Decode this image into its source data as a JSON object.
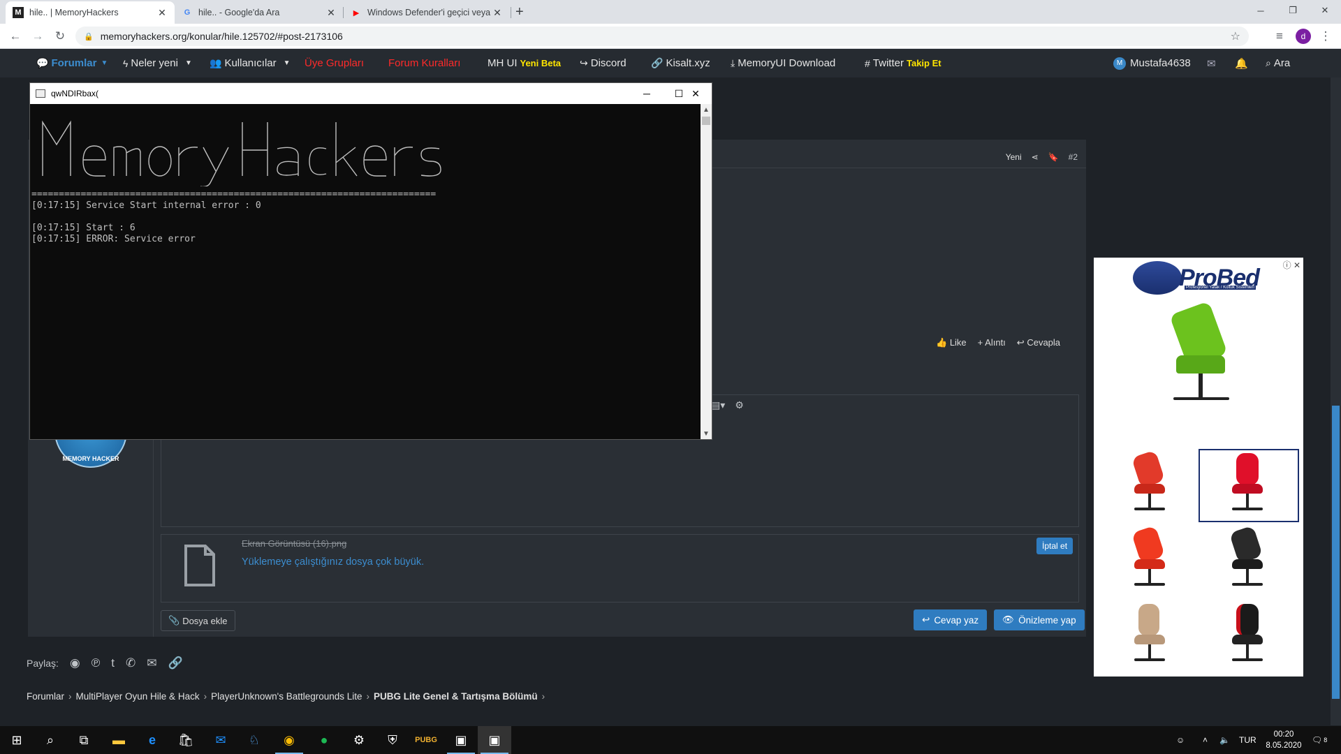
{
  "browser": {
    "tabs": [
      {
        "title": "hile.. | MemoryHackers",
        "favicon": "M"
      },
      {
        "title": "hile.. - Google'da Ara",
        "favicon": "G"
      },
      {
        "title": "Windows Defender'i geçici veya k",
        "favicon": "▶"
      }
    ],
    "url": "memoryhackers.org/konular/hile.125702/#post-2173106",
    "profile_initial": "d"
  },
  "forum_nav": {
    "forums": "Forumlar",
    "whats_new": "Neler yeni",
    "members": "Kullanıcılar",
    "groups": "Üye Grupları",
    "rules": "Forum Kuralları",
    "mhui": "MH UI",
    "mhui_badge": "Yeni Beta",
    "discord": "Discord",
    "kisalt": "Kisalt.xyz",
    "download": "MemoryUI Download",
    "twitter": "Twitter",
    "twitter_badge": "Takip Et",
    "username": "Mustafa4638",
    "search": "Ara"
  },
  "post": {
    "new_label": "Yeni",
    "number": "#2",
    "like": "Like",
    "quote": "Alıntı",
    "reply": "Cevapla"
  },
  "attachment": {
    "filename": "Ekran Görüntüsü (16).png",
    "error": "Yüklemeye çalıştığınız dosya çok büyük.",
    "cancel": "İptal et"
  },
  "buttons": {
    "add_file": "Dosya ekle",
    "post_reply": "Cevap yaz",
    "preview": "Önizleme yap"
  },
  "share": {
    "label": "Paylaş:"
  },
  "breadcrumb": [
    "Forumlar",
    "MultiPlayer Oyun Hile & Hack",
    "PlayerUnknown's Battlegrounds Lite",
    "PUBG Lite Genel & Tartışma Bölümü"
  ],
  "logo_text": "MEMORY HACKER",
  "ad": {
    "brand": "ProBed",
    "tagline": "Profesyonel Yatak / Koltuk Sistemleri"
  },
  "console": {
    "title": "qwNDIRbax(",
    "separator": "==========================================================================",
    "lines": [
      "[0:17:15] Service Start internal error : 0",
      "",
      "[0:17:15] Start : 6",
      "[0:17:15] ERROR: Service error"
    ]
  },
  "taskbar": {
    "language": "TUR",
    "time": "00:20",
    "date": "8.05.2020",
    "notification_count": "8"
  },
  "colors": {
    "accent_blue": "#2f7cc0",
    "nav_red": "#ff2a2a",
    "badge_yellow": "#ffe500",
    "forum_bg": "#1e2227"
  }
}
